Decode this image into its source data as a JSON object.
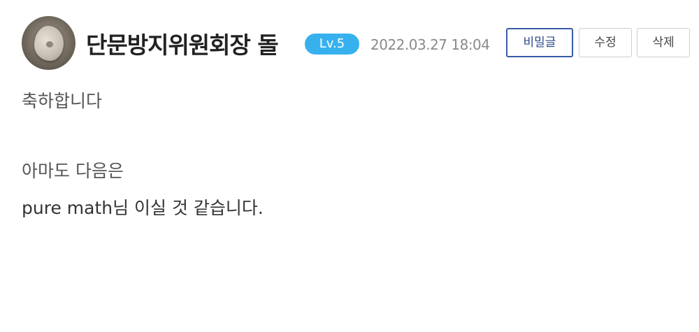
{
  "comment": {
    "avatar_icon": "stone-avatar",
    "username": "단문방지위원회장 돌",
    "level": "Lv.5",
    "timestamp": "2022.03.27 18:04",
    "buttons": {
      "secret_label": "비밀글",
      "edit_label": "수정",
      "delete_label": "삭제"
    },
    "body": {
      "line1": "축하합니다",
      "line2": "아마도 다음은",
      "line3": "pure math님 이실 것 같습니다."
    },
    "colors": {
      "level_badge": "#37b1ee",
      "secret_button_border": "#3a5ba8"
    }
  }
}
